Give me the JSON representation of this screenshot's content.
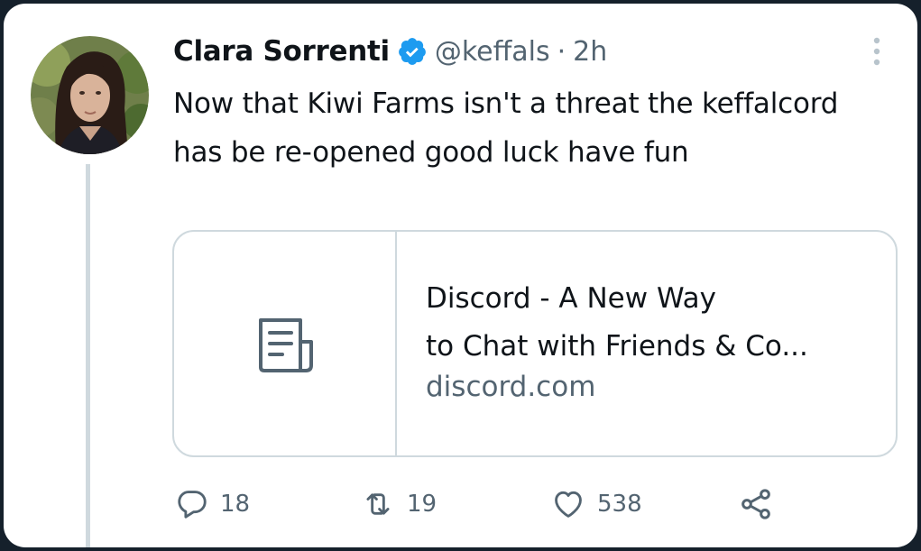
{
  "tweet": {
    "display_name": "Clara Sorrenti",
    "handle": "@keffals",
    "separator": "·",
    "time": "2h",
    "text": "Now that Kiwi Farms isn't a threat the keffalcord has be re-opened good luck have fun",
    "verified": true
  },
  "link_card": {
    "title_line_1": "Discord - A New Way",
    "title_line_2": "to Chat with Friends & Co...",
    "domain": "discord.com",
    "thumbnail_icon": "document-icon"
  },
  "actions": {
    "reply_count": "18",
    "retweet_count": "19",
    "like_count": "538",
    "icons": [
      "reply-icon",
      "retweet-icon",
      "like-icon",
      "share-icon"
    ]
  },
  "colors": {
    "background": "#15202b",
    "card": "#ffffff",
    "text": "#0f1419",
    "secondary_text": "#536471",
    "border": "#cfd9de",
    "verified_blue": "#1d9bf0"
  }
}
